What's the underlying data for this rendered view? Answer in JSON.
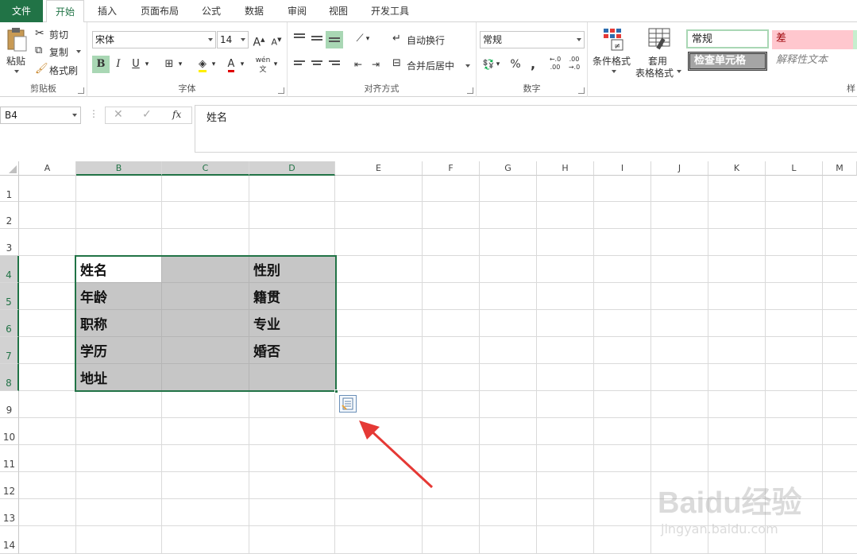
{
  "tabs": [
    "文件",
    "开始",
    "插入",
    "页面布局",
    "公式",
    "数据",
    "审阅",
    "视图",
    "开发工具"
  ],
  "clipboard": {
    "paste": "粘贴",
    "cut": "剪切",
    "copy": "复制",
    "format_painter": "格式刷",
    "label": "剪贴板"
  },
  "font": {
    "name": "宋体",
    "size": "14",
    "label": "字体",
    "bold": "B",
    "italic": "I",
    "underline": "U",
    "phonetic": "wén"
  },
  "alignment": {
    "wrap": "自动换行",
    "merge": "合并后居中",
    "label": "对齐方式"
  },
  "number": {
    "format": "常规",
    "percent": "%",
    "comma": ",",
    "label": "数字"
  },
  "styles": {
    "conditional": "条件格式",
    "table_line1": "套用",
    "table_line2": "表格格式",
    "normal": "常规",
    "bad": "差",
    "check": "检查单元格",
    "explanatory": "解释性文本",
    "label": "样"
  },
  "formula_bar": {
    "name_box": "B4",
    "fx": "fx",
    "content": "姓名"
  },
  "columns": [
    "A",
    "B",
    "C",
    "D",
    "E",
    "F",
    "G",
    "H",
    "I",
    "J",
    "K",
    "L",
    "M"
  ],
  "rows": [
    "1",
    "2",
    "3",
    "4",
    "5",
    "6",
    "7",
    "8",
    "9",
    "10",
    "11",
    "12",
    "13",
    "14"
  ],
  "cells": {
    "B4": "姓名",
    "D4": "性别",
    "B5": "年龄",
    "D5": "籍贯",
    "B6": "职称",
    "D6": "专业",
    "B7": "学历",
    "D7": "婚否",
    "B8": "地址"
  },
  "watermark": {
    "brand": "Baidu经验",
    "url": "jingyan.baidu.com"
  },
  "colors": {
    "accent": "#217346",
    "selection": "#c6c6c6",
    "arrow": "#e53935",
    "bad_bg": "#ffc7ce",
    "check_bg": "#a5a5a5"
  }
}
